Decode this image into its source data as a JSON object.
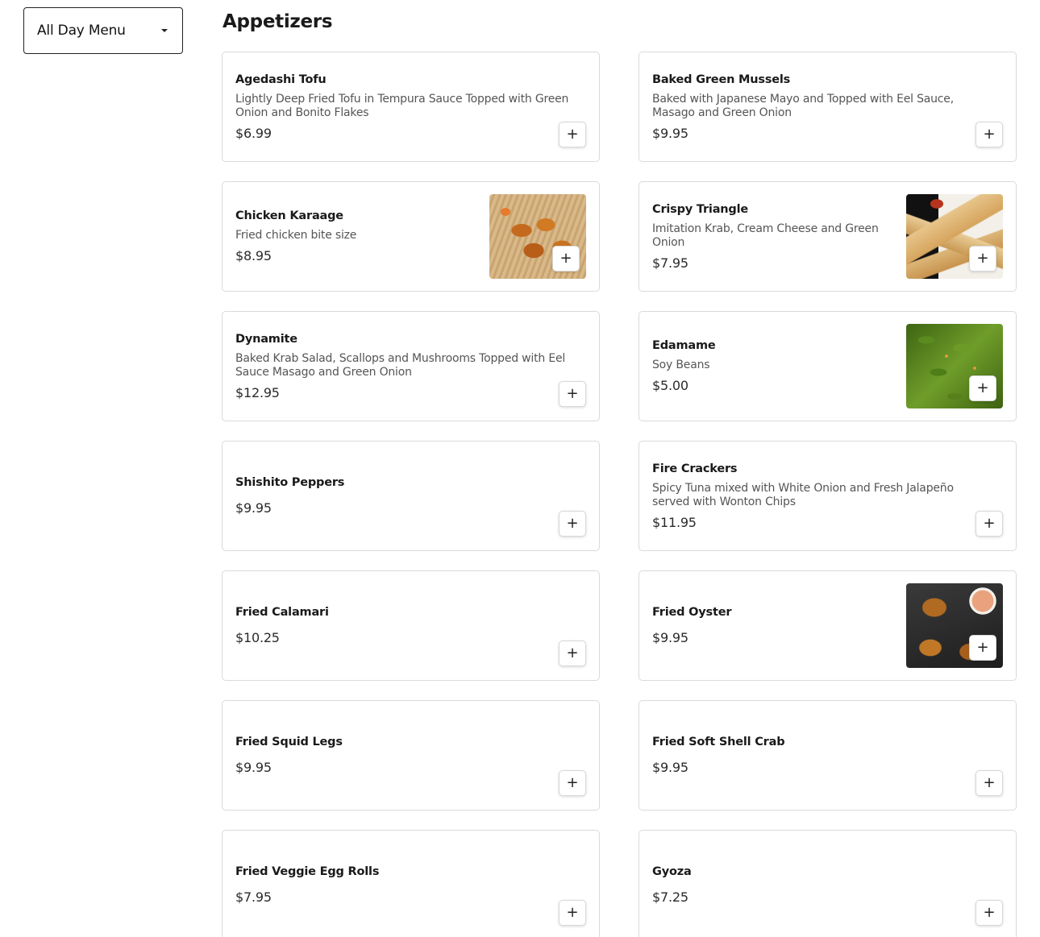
{
  "menu_selector": {
    "label": "All Day Menu"
  },
  "section": {
    "title": "Appetizers"
  },
  "add_label": "+",
  "items": [
    {
      "name": "Agedashi Tofu",
      "description": "Lightly Deep Fried Tofu in Tempura Sauce Topped with Green Onion and Bonito Flakes",
      "price": "$6.99"
    },
    {
      "name": "Baked Green Mussels",
      "description": "Baked with Japanese Mayo and Topped with Eel Sauce, Masago and Green Onion",
      "price": "$9.95"
    },
    {
      "name": "Chicken Karaage",
      "description": "Fried chicken bite size",
      "price": "$8.95"
    },
    {
      "name": "Crispy Triangle",
      "description": "Imitation Krab, Cream Cheese and Green Onion",
      "price": "$7.95"
    },
    {
      "name": "Dynamite",
      "description": "Baked Krab Salad, Scallops and Mushrooms Topped with Eel Sauce Masago and Green Onion",
      "price": "$12.95"
    },
    {
      "name": "Edamame",
      "description": "Soy Beans",
      "price": "$5.00"
    },
    {
      "name": "Shishito Peppers",
      "description": "",
      "price": "$9.95"
    },
    {
      "name": "Fire Crackers",
      "description": "Spicy Tuna mixed with White Onion and Fresh Jalapeño served with Wonton Chips",
      "price": "$11.95"
    },
    {
      "name": "Fried Calamari",
      "description": "",
      "price": "$10.25"
    },
    {
      "name": "Fried Oyster",
      "description": "",
      "price": "$9.95"
    },
    {
      "name": "Fried Squid Legs",
      "description": "",
      "price": "$9.95"
    },
    {
      "name": "Fried Soft Shell Crab",
      "description": "",
      "price": "$9.95"
    },
    {
      "name": "Fried Veggie Egg Rolls",
      "description": "",
      "price": "$7.95"
    },
    {
      "name": "Gyoza",
      "description": "",
      "price": "$7.25"
    }
  ]
}
